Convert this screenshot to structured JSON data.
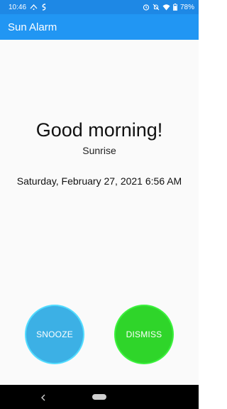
{
  "status_bar": {
    "time": "10:46",
    "battery": "78%",
    "left_icons": [
      "sensors-icon",
      "data-saver-icon"
    ],
    "right_icons": [
      "alarm-icon",
      "notifications-off-icon",
      "wifi-icon",
      "battery-icon"
    ]
  },
  "app_bar": {
    "title": "Sun Alarm"
  },
  "main": {
    "greeting": "Good morning!",
    "event": "Sunrise",
    "datetime": "Saturday, February 27, 2021 6:56 AM"
  },
  "actions": {
    "snooze_label": "SNOOZE",
    "dismiss_label": "DISMISS"
  },
  "colors": {
    "app_bar": "#2196f3",
    "status_bar": "#1e88e5",
    "snooze": "#3cb0e5",
    "dismiss": "#2fd52a"
  }
}
